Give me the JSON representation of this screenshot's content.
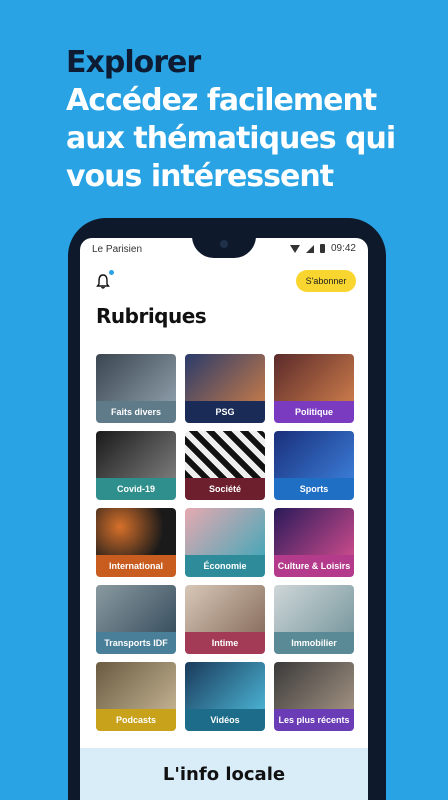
{
  "promo": {
    "line1": "Explorer",
    "line2": "Accédez facilement",
    "line3": "aux thématiques qui",
    "line4": "vous intéressent"
  },
  "statusbar": {
    "app_name": "Le Parisien",
    "time": "09:42"
  },
  "header": {
    "subscribe_label": "S'abonner",
    "title": "Rubriques"
  },
  "colors": {
    "background": "#29a3e3",
    "subscribe": "#f9d52f",
    "accent_dark": "#0d1b33"
  },
  "categories": [
    {
      "label": "Faits divers",
      "color": "#5f7b8a",
      "icon": "police-photo"
    },
    {
      "label": "PSG",
      "color": "#1b2b57",
      "icon": "football-photo"
    },
    {
      "label": "Politique",
      "color": "#7b3bc0",
      "icon": "parliament-photo"
    },
    {
      "label": "Covid-19",
      "color": "#2f8f8c",
      "icon": "mask-photo"
    },
    {
      "label": "Société",
      "color": "#6e1f2d",
      "icon": "crowd-photo"
    },
    {
      "label": "Sports",
      "color": "#1f6fc4",
      "icon": "tennis-photo"
    },
    {
      "label": "International",
      "color": "#c95d1f",
      "icon": "globe-photo"
    },
    {
      "label": "Économie",
      "color": "#2e8c9a",
      "icon": "coin-photo"
    },
    {
      "label": "Culture & Loisirs",
      "color": "#b43b8b",
      "icon": "concert-photo"
    },
    {
      "label": "Transports IDF",
      "color": "#4a7f99",
      "icon": "metro-photo"
    },
    {
      "label": "Intime",
      "color": "#a33b57",
      "icon": "hands-photo"
    },
    {
      "label": "Immobilier",
      "color": "#5a8a96",
      "icon": "building-photo"
    },
    {
      "label": "Podcasts",
      "color": "#c9a21b",
      "icon": "microphone-photo"
    },
    {
      "label": "Vidéos",
      "color": "#1d6d8a",
      "icon": "camera-photo"
    },
    {
      "label": "Les plus récents",
      "color": "#6a3cb5",
      "icon": "phone-photo"
    }
  ],
  "local": {
    "title": "L'info locale"
  }
}
